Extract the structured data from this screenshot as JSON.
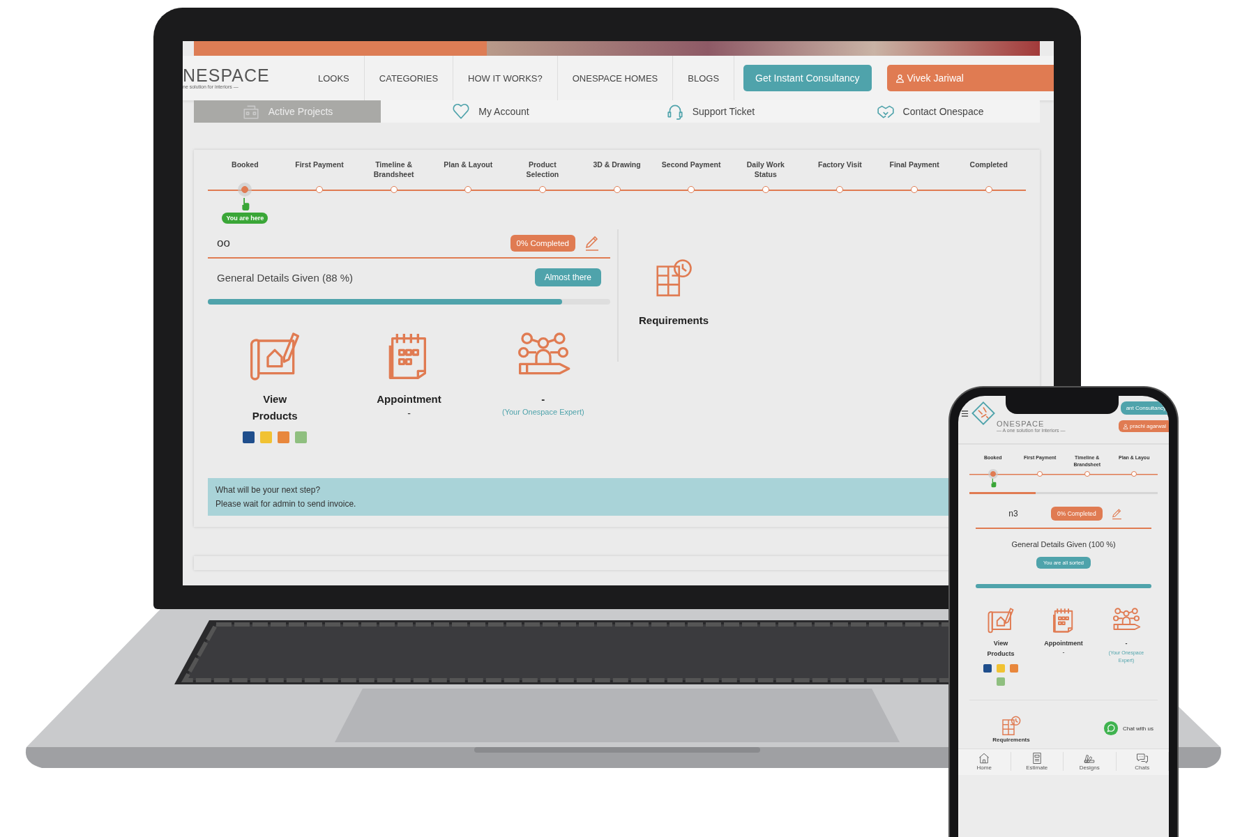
{
  "laptop": {
    "header": {
      "logo": "NESPACE",
      "tagline": "ne solution for interiors —",
      "nav": [
        "LOOKS",
        "CATEGORIES",
        "HOW IT WORKS?",
        "ONESPACE HOMES",
        "BLOGS"
      ],
      "cta": "Get Instant Consultancy",
      "user": "Vivek Jariwal"
    },
    "subnav": [
      {
        "label": "Active Projects",
        "selected": true
      },
      {
        "label": "My Account",
        "selected": false
      },
      {
        "label": "Support Ticket",
        "selected": false
      },
      {
        "label": "Contact Onespace",
        "selected": false
      }
    ],
    "steps": [
      {
        "label": "Booked",
        "current": true
      },
      {
        "label": "First Payment",
        "current": false
      },
      {
        "label": "Timeline & Brandsheet",
        "current": false
      },
      {
        "label": "Plan & Layout",
        "current": false
      },
      {
        "label": "Product Selection",
        "current": false
      },
      {
        "label": "3D & Drawing",
        "current": false
      },
      {
        "label": "Second Payment",
        "current": false
      },
      {
        "label": "Daily Work Status",
        "current": false
      },
      {
        "label": "Factory Visit",
        "current": false
      },
      {
        "label": "Final Payment",
        "current": false
      },
      {
        "label": "Completed",
        "current": false
      }
    ],
    "marker": "You are here",
    "project": {
      "name": "oo",
      "badge": "0% Completed",
      "details": "General Details Given (88 %)",
      "status": "Almost there",
      "level": 0.88
    },
    "actions": [
      {
        "kind": "products",
        "title": "View Products",
        "colors": [
          {
            "color": "#1f4e8c"
          },
          {
            "color": "#f1c232"
          },
          {
            "color": "#e8873c"
          },
          {
            "color": "#8fbf7f"
          }
        ]
      },
      {
        "kind": "appointment",
        "title": "Appointment",
        "value": "-"
      },
      {
        "kind": "expert",
        "title": "-",
        "note": "(Your Onespace Expert)"
      }
    ],
    "requirements": "Requirements",
    "next_step": {
      "question": "What will be your next step?",
      "message": "Please wait for admin to send invoice."
    }
  },
  "phone": {
    "header": {
      "logo": "ONESPACE",
      "tagline": "— A one solution for interiors —",
      "cta": "ant Consultancy",
      "user": "prachi agarwal"
    },
    "steps": [
      {
        "label": "Booked",
        "current": true
      },
      {
        "label": "First Payment",
        "current": false
      },
      {
        "label": "Timeline & Brandsheet",
        "current": false
      },
      {
        "label": "Plan & Layou",
        "current": false
      }
    ],
    "project": {
      "name": "n3",
      "badge": "0% Completed",
      "details": "General Details Given (100 %)",
      "status": "You are all sorted",
      "level": 1
    },
    "actions": [
      {
        "kind": "products",
        "title": "View Products",
        "colors": [
          {
            "color": "#1f4e8c"
          },
          {
            "color": "#f1c232"
          },
          {
            "color": "#e8873c"
          },
          {
            "color": "#8fbf7f"
          }
        ]
      },
      {
        "kind": "appointment",
        "title": "Appointment",
        "value": "-"
      },
      {
        "kind": "expert",
        "title": "-",
        "note": "(Your Onespace Expert)"
      }
    ],
    "requirements": "Requirements",
    "chat": "Chat with us",
    "tabs": [
      "Home",
      "Estimate",
      "Designs",
      "Chats"
    ]
  }
}
